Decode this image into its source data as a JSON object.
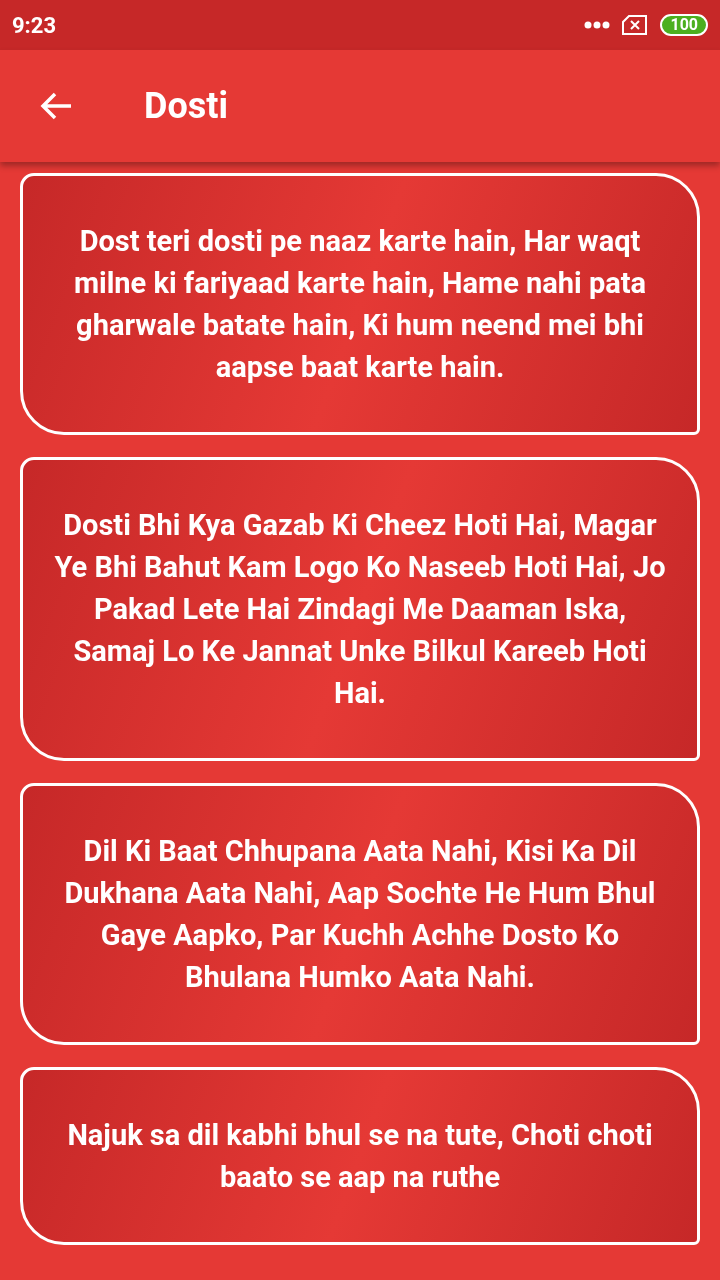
{
  "status_bar": {
    "time": "9:23",
    "battery": "100"
  },
  "app_bar": {
    "title": "Dosti"
  },
  "quotes": [
    {
      "text": "Dost teri dosti pe naaz karte hain, Har waqt milne ki fariyaad karte hain, Hame nahi pata gharwale batate hain, Ki hum neend mei bhi aapse baat karte hain."
    },
    {
      "text": "Dosti Bhi Kya Gazab Ki Cheez Hoti Hai, Magar Ye Bhi Bahut Kam Logo Ko Naseeb Hoti Hai, Jo Pakad Lete Hai Zindagi Me Daaman Iska, Samaj Lo Ke Jannat Unke Bilkul Kareeb Hoti Hai."
    },
    {
      "text": "Dil Ki Baat Chhupana Aata Nahi, Kisi Ka Dil Dukhana Aata Nahi, Aap Sochte He Hum Bhul Gaye Aapko, Par Kuchh Achhe Dosto Ko Bhulana Humko Aata Nahi."
    },
    {
      "text": "Najuk sa dil kabhi bhul se na tute, Choti choti baato se aap na ruthe"
    }
  ]
}
